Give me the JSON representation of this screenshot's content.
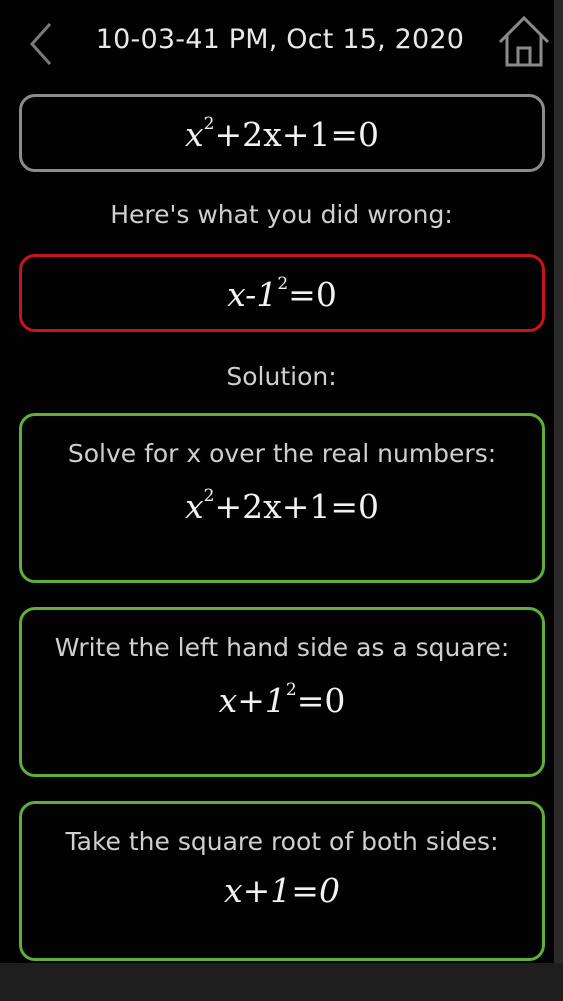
{
  "header": {
    "timestamp": "10-03-41 PM, Oct 15, 2020",
    "back_icon": "chevron-left-icon",
    "home_icon": "home-icon"
  },
  "problem": {
    "equation_base": "x",
    "equation_exp": "2",
    "equation_rest": "+2x+1=0"
  },
  "mistake": {
    "label": "Here's what you did wrong:",
    "equation_base": "x-1",
    "equation_exp": "2",
    "equation_rest": "=0"
  },
  "solution": {
    "label": "Solution:",
    "steps": [
      {
        "text": "Solve for x over the real numbers:",
        "equation_base": "x",
        "equation_exp": "2",
        "equation_rest": "+2x+1=0"
      },
      {
        "text": "Write the left hand side as a square:",
        "equation_base": "x+1",
        "equation_exp": "2",
        "equation_rest": "=0"
      },
      {
        "text": "Take the square root of both sides:",
        "equation": "x+1=0"
      }
    ]
  },
  "colors": {
    "background": "#020202",
    "input_border": "#8b8b8b",
    "error_border": "#c8141e",
    "step_border": "#5fae3a",
    "text": "#cfcfcf"
  }
}
